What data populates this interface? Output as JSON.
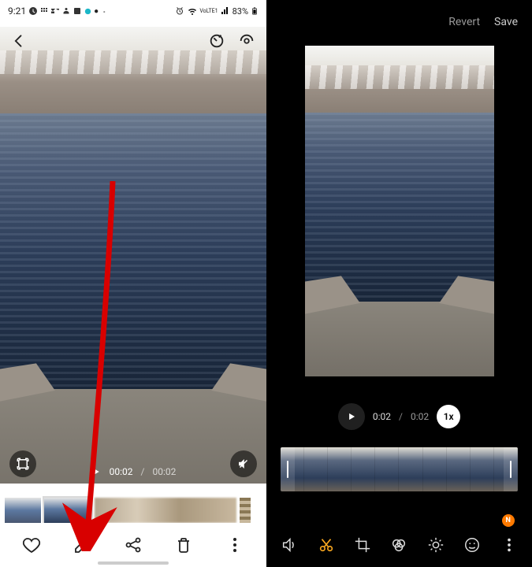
{
  "status": {
    "time": "9:21",
    "lte_label": "VoLTE1",
    "battery": "83%"
  },
  "left": {
    "playback": {
      "current": "00:02",
      "duration": "00:02"
    }
  },
  "right": {
    "header": {
      "revert": "Revert",
      "save": "Save"
    },
    "playback": {
      "current": "0:02",
      "duration": "0:02",
      "speed": "1x"
    },
    "notif": "N"
  }
}
